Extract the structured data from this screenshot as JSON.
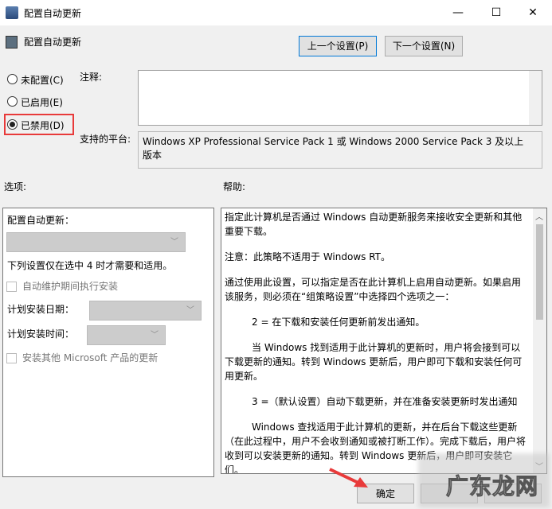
{
  "window": {
    "title": "配置自动更新",
    "minimize": "—",
    "maximize": "☐",
    "close": "✕"
  },
  "header": {
    "title": "配置自动更新",
    "prev_button": "上一个设置(P)",
    "next_button": "下一个设置(N)"
  },
  "state": {
    "not_configured": "未配置(C)",
    "enabled": "已启用(E)",
    "disabled": "已禁用(D)",
    "selected": "disabled"
  },
  "comment_label": "注释:",
  "platform_label": "支持的平台:",
  "platform_value": "Windows XP Professional Service Pack 1 或 Windows 2000 Service Pack 3 及以上版本",
  "options_label": "选项:",
  "help_label": "帮助:",
  "options": {
    "configure_label": "配置自动更新：",
    "note": "下列设置仅在选中 4 时才需要和适用。",
    "maint_checkbox": "自动维护期间执行安装",
    "day_label": "计划安装日期：",
    "time_label": "计划安装时间：",
    "other_checkbox": "安装其他 Microsoft 产品的更新"
  },
  "help": [
    "指定此计算机是否通过 Windows 自动更新服务来接收安全更新和其他重要下载。",
    "注意：此策略不适用于 Windows RT。",
    "通过使用此设置，可以指定是否在此计算机上启用自动更新。如果启用该服务，则必须在“组策略设置”中选择四个选项之一：",
    "2 = 在下载和安装任何更新前发出通知。",
    "当 Windows 找到适用于此计算机的更新时，用户将会接到可以下载更新的通知。转到 Windows 更新后，用户即可下载和安装任何可用更新。",
    "3 =（默认设置）自动下载更新，并在准备安装更新时发出通知",
    "Windows 查找适用于此计算机的更新，并在后台下载这些更新（在此过程中，用户不会收到通知或被打断工作）。完成下载后，用户将收到可以安装更新的通知。转到 Windows 更新后，用户即可安装它们。"
  ],
  "footer": {
    "ok": "确定"
  },
  "watermark": "广东龙网"
}
